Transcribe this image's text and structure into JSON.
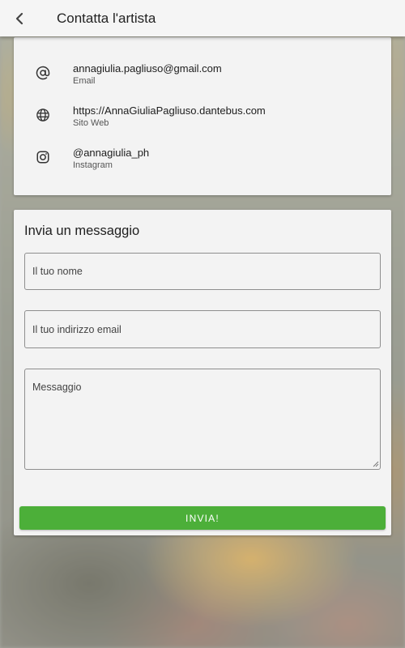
{
  "header": {
    "title": "Contatta l'artista",
    "back_icon": "chevron-left-icon"
  },
  "contacts": [
    {
      "icon": "at-sign-icon",
      "value": "annagiulia.pagliuso@gmail.com",
      "label": "Email"
    },
    {
      "icon": "globe-icon",
      "value": "https://AnnaGiuliaPagliuso.dantebus.com",
      "label": "Sito Web"
    },
    {
      "icon": "instagram-icon",
      "value": "@annagiulia_ph",
      "label": "Instagram"
    }
  ],
  "form": {
    "title": "Invia un messaggio",
    "name_placeholder": "Il tuo nome",
    "email_placeholder": "Il tuo indirizzo email",
    "message_placeholder": "Messaggio",
    "submit_label": "INVIA!"
  },
  "colors": {
    "accent": "#4caf39",
    "card_background": "#f3f3f3",
    "appbar_background": "#f5f5f5"
  }
}
